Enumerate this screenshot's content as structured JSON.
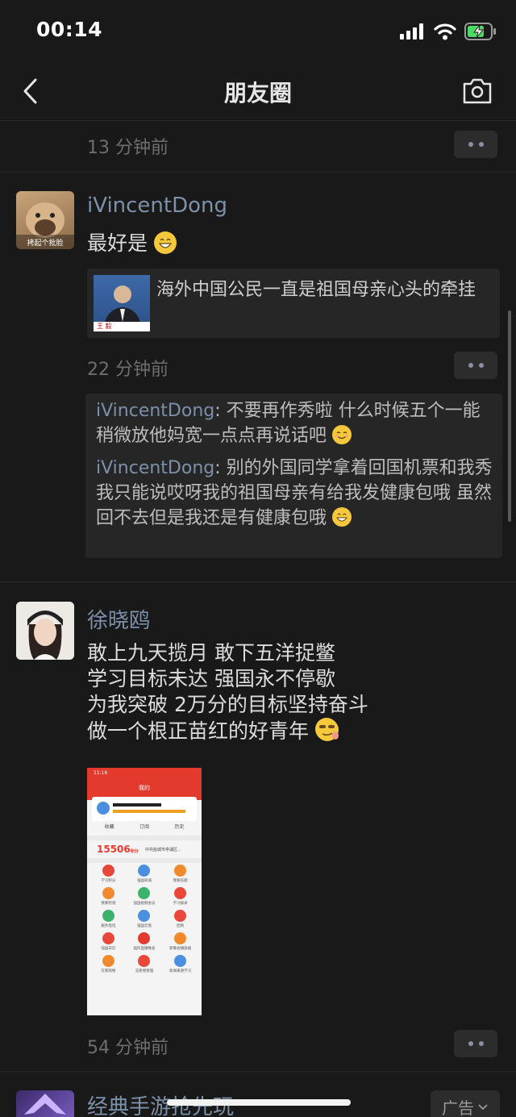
{
  "status_bar": {
    "time": "00:14"
  },
  "nav": {
    "title": "朋友圈"
  },
  "posts": [
    {
      "time": "13 分钟前"
    },
    {
      "username": "iVincentDong",
      "avatar_caption": "拷起个批脸",
      "text": "最好是",
      "link": {
        "thumb_caption": "王 毅",
        "title": "海外中国公民一直是祖国母亲心头的牵挂"
      },
      "time": "22 分钟前",
      "comments": [
        {
          "name": "iVincentDong",
          "text": ": 不要再作秀啦 什么时候五个一能稍微放他妈宽一点点再说话吧"
        },
        {
          "name": "iVincentDong",
          "text": ": 别的外国同学拿着回国机票和我秀 我只能说哎呀我的祖国母亲有给我发健康包哦 虽然回不去但是我还是有健康包哦"
        }
      ]
    },
    {
      "username": "徐晓鸥",
      "text_lines": [
        "敢上九天揽月 敢下五洋捉鳖",
        "学习目标未达 强国永不停歇",
        "为我突破 2万分的目标坚持奋斗",
        "做一个根正苗红的好青年"
      ],
      "image": {
        "status_time": "11:16",
        "header": "我的",
        "tabs": [
          "收藏",
          "订阅",
          "历史"
        ],
        "score": "15506",
        "score_unit": "积分",
        "org": "中共盐城市亭湖区...",
        "grid": [
          "学习积分",
          "强国商城",
          "我要答题",
          "我要检测",
          "强国视频会议",
          "学习报表",
          "服务电话",
          "强国云盘",
          "团购",
          "强国日历",
          "国庆直播晚会",
          "新晚会播放器",
          "在家购物",
          "志愿者管理",
          "新闻来源学习"
        ]
      },
      "time": "54 分钟前"
    },
    {
      "username": "经典手游抢先玩",
      "ad_label": "广告"
    }
  ]
}
